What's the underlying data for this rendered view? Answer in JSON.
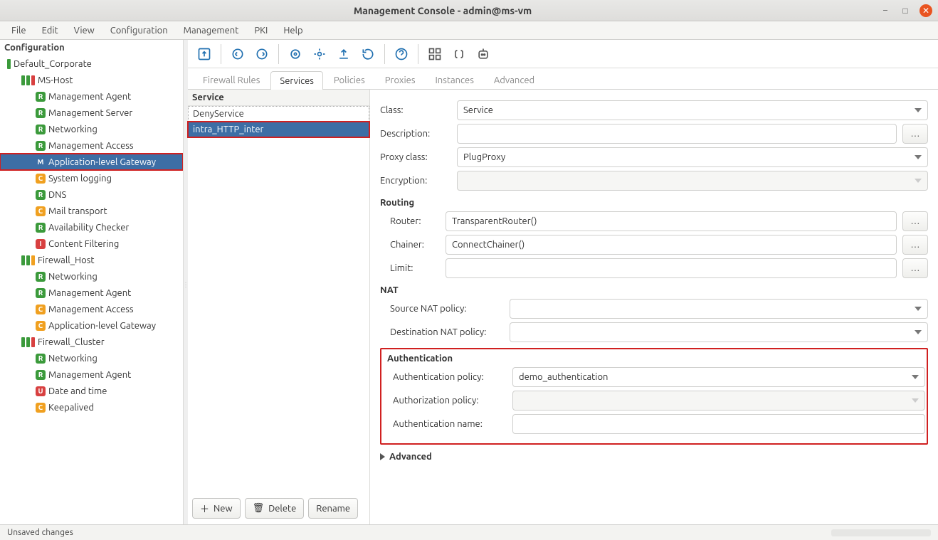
{
  "window": {
    "title": "Management Console - admin@ms-vm"
  },
  "menu": [
    "File",
    "Edit",
    "View",
    "Configuration",
    "Management",
    "PKI",
    "Help"
  ],
  "sidebar": {
    "heading": "Configuration",
    "tree": [
      {
        "depth": 0,
        "bars": [
          "g"
        ],
        "label": "Default_Corporate"
      },
      {
        "depth": 1,
        "bars": [
          "g",
          "g",
          "r"
        ],
        "label": "MS-Host"
      },
      {
        "depth": 2,
        "badge": "R",
        "label": "Management Agent"
      },
      {
        "depth": 2,
        "badge": "R",
        "label": "Management Server"
      },
      {
        "depth": 2,
        "badge": "R",
        "label": "Networking"
      },
      {
        "depth": 2,
        "badge": "R",
        "label": "Management Access"
      },
      {
        "depth": 2,
        "badge": "M",
        "label": "Application-level Gateway",
        "selected": true
      },
      {
        "depth": 2,
        "badge": "C",
        "label": "System logging"
      },
      {
        "depth": 2,
        "badge": "R",
        "label": "DNS"
      },
      {
        "depth": 2,
        "badge": "C",
        "label": "Mail transport"
      },
      {
        "depth": 2,
        "badge": "R",
        "label": "Availability Checker"
      },
      {
        "depth": 2,
        "badge": "I",
        "label": "Content Filtering"
      },
      {
        "depth": 1,
        "bars": [
          "g",
          "g",
          "y"
        ],
        "label": "Firewall_Host"
      },
      {
        "depth": 2,
        "badge": "R",
        "label": "Networking"
      },
      {
        "depth": 2,
        "badge": "R",
        "label": "Management Agent"
      },
      {
        "depth": 2,
        "badge": "C",
        "label": "Management Access"
      },
      {
        "depth": 2,
        "badge": "C",
        "label": "Application-level Gateway"
      },
      {
        "depth": 1,
        "bars": [
          "g",
          "g",
          "r"
        ],
        "label": "Firewall_Cluster"
      },
      {
        "depth": 2,
        "badge": "R",
        "label": "Networking"
      },
      {
        "depth": 2,
        "badge": "R",
        "label": "Management Agent"
      },
      {
        "depth": 2,
        "badge": "U",
        "label": "Date and time"
      },
      {
        "depth": 2,
        "badge": "C",
        "label": "Keepalived"
      }
    ]
  },
  "tabs": [
    "Firewall Rules",
    "Services",
    "Policies",
    "Proxies",
    "Instances",
    "Advanced"
  ],
  "tabs_active_index": 1,
  "service_list": {
    "heading": "Service",
    "items": [
      {
        "label": "DenyService"
      },
      {
        "label": "intra_HTTP_inter",
        "selected": true
      }
    ],
    "actions": {
      "new": "New",
      "delete": "Delete",
      "rename": "Rename"
    }
  },
  "form": {
    "labels": {
      "class": "Class:",
      "description": "Description:",
      "proxy_class": "Proxy class:",
      "encryption": "Encryption:",
      "routing": "Routing",
      "router": "Router:",
      "chainer": "Chainer:",
      "limit": "Limit:",
      "nat": "NAT",
      "snat": "Source NAT policy:",
      "dnat": "Destination NAT policy:",
      "auth": "Authentication",
      "auth_policy": "Authentication policy:",
      "authz_policy": "Authorization policy:",
      "auth_name": "Authentication name:",
      "advanced": "Advanced"
    },
    "values": {
      "class": "Service",
      "description": "",
      "proxy_class": "PlugProxy",
      "encryption": "",
      "router": "TransparentRouter()",
      "chainer": "ConnectChainer()",
      "limit": "",
      "snat": "",
      "dnat": "",
      "auth_policy": "demo_authentication",
      "authz_policy": "",
      "auth_name": ""
    }
  },
  "status": {
    "text": "Unsaved changes"
  }
}
